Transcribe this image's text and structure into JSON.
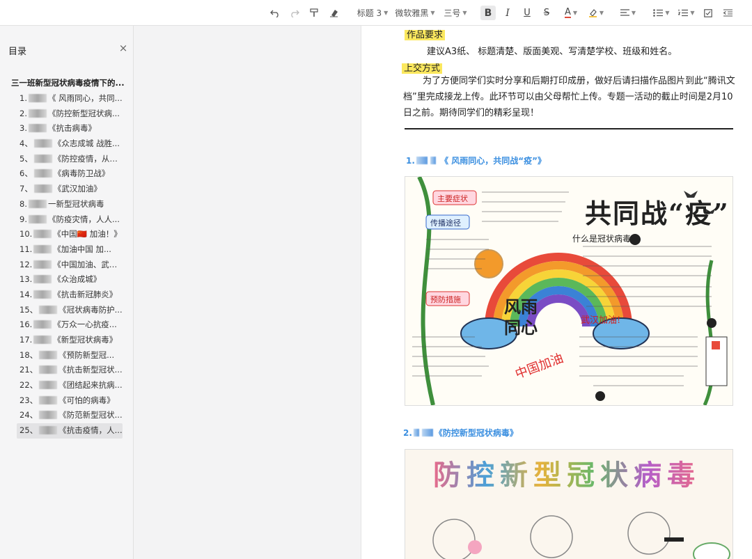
{
  "toolbar": {
    "heading_style": "标题 3",
    "font_family": "微软雅黑",
    "font_size": "三号",
    "icons": [
      "undo-icon",
      "redo-icon",
      "format-painter-icon",
      "clear-format-icon",
      "bold-icon",
      "italic-icon",
      "underline-icon",
      "strikethrough-icon",
      "font-color-icon",
      "highlight-icon",
      "align-icon",
      "bullet-list-icon",
      "numbered-list-icon",
      "checkbox-icon",
      "outdent-icon"
    ],
    "font_color": "#e04a3a",
    "highlight_color": "#f6c343"
  },
  "toc": {
    "title": "目录",
    "close": "×",
    "doc_title": "三一班新型冠状病毒疫情下的...",
    "items": [
      {
        "num": "1.",
        "text": "《 风雨同心，共同..."
      },
      {
        "num": "2.",
        "text": "《防控新型冠状病..."
      },
      {
        "num": "3.",
        "text": "《抗击病毒》"
      },
      {
        "num": "4、",
        "text": "《众志成城 战胜..."
      },
      {
        "num": "5、",
        "text": "《防控疫情，从我..."
      },
      {
        "num": "6、",
        "text": "《病毒防卫战》"
      },
      {
        "num": "7、",
        "text": "《武汉加油》"
      },
      {
        "num": "8.",
        "text": "一新型冠状病毒"
      },
      {
        "num": "9.",
        "text": "《防疫灾情，人人..."
      },
      {
        "num": "10.",
        "text": "《中国🇨🇳 加油！》"
      },
      {
        "num": "11.",
        "text": "《加油中国 加..."
      },
      {
        "num": "12.",
        "text": "《中国加油、武汉..."
      },
      {
        "num": "13.",
        "text": "《众治成城》"
      },
      {
        "num": "14.",
        "text": "《抗击新冠肺炎》"
      },
      {
        "num": "15、",
        "text": "《冠状病毒防护..."
      },
      {
        "num": "16.",
        "text": "《万众一心抗疫..."
      },
      {
        "num": "17.",
        "text": "《新型冠状病毒》"
      },
      {
        "num": "18、",
        "text": "《预防新型冠..."
      },
      {
        "num": "21、",
        "text": "《抗击新型冠状..."
      },
      {
        "num": "22、",
        "text": "《团结起来抗病..."
      },
      {
        "num": "23、",
        "text": "《可怕的病毒》"
      },
      {
        "num": "24、",
        "text": "《防范新型冠状..."
      },
      {
        "num": "25、",
        "text": "《抗击疫情，人..."
      }
    ],
    "selected_index": 22
  },
  "doc": {
    "section1_label": "作品要求",
    "section1_text": "建议A3纸、 标题清楚、版面美观、写清楚学校、班级和姓名。",
    "section2_label": "上交方式",
    "section2_text": "为了方便同学们实时分享和后期打印成册，做好后请扫描作品图片到此“腾讯文档”里完成接龙上传。此环节可以由父母帮忙上传。专题一活动的截止时间是2月10日之前。期待同学们的精彩呈现！",
    "heading1_num": "1.",
    "heading1_text": "《  风雨同心，共同战“疫”》",
    "heading2_num": "2.",
    "heading2_text": "《防控新型冠状病毒》",
    "poster1": {
      "title": "共同战“疫”",
      "center": "风雨同心",
      "label_a": "主要症状",
      "label_b": "传播途径",
      "label_c": "预防措施",
      "label_d": "什么是冠状病毒",
      "label_e": "武汉加油!",
      "slogan": "中国加油"
    },
    "poster2": {
      "title": "防控新型冠状病毒"
    },
    "heading_color": "#3b8fe0",
    "highlight_color": "#fbe85e"
  }
}
